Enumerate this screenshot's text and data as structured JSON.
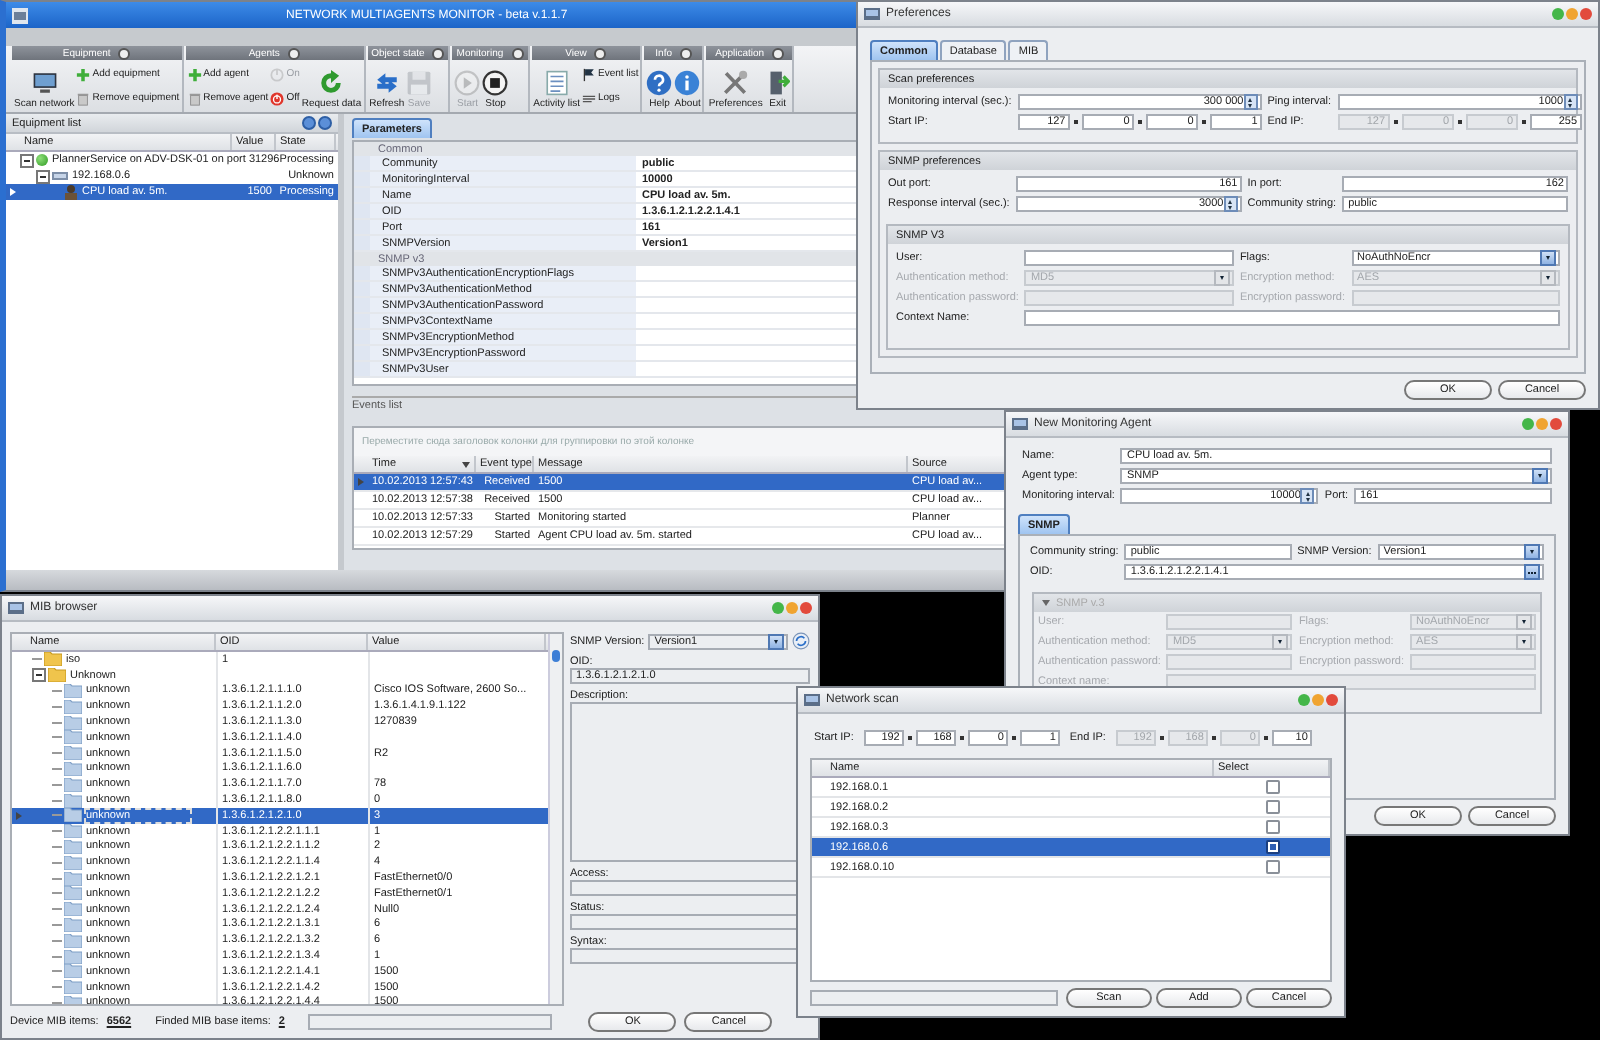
{
  "main_window": {
    "title": "NETWORK MULTIAGENTS MONITOR - beta v.1.1.7",
    "ribbon": [
      {
        "title": "Equipment",
        "buttons": [
          {
            "label": "Scan network",
            "kind": "large",
            "disabled": false
          },
          {
            "label": "Add equipment",
            "kind": "small",
            "disabled": false
          },
          {
            "label": "Remove equipment",
            "kind": "small",
            "disabled": false
          }
        ]
      },
      {
        "title": "Agents",
        "buttons": [
          {
            "label": "Add agent",
            "kind": "small",
            "disabled": false
          },
          {
            "label": "Remove agent",
            "kind": "small",
            "disabled": false
          },
          {
            "label": "On",
            "kind": "small",
            "disabled": true
          },
          {
            "label": "Off",
            "kind": "small",
            "disabled": false
          },
          {
            "label": "Request data",
            "kind": "large",
            "disabled": false
          }
        ]
      },
      {
        "title": "Object state",
        "buttons": [
          {
            "label": "Refresh",
            "kind": "large",
            "disabled": false
          },
          {
            "label": "Save",
            "kind": "large",
            "disabled": true
          }
        ]
      },
      {
        "title": "Monitoring",
        "buttons": [
          {
            "label": "Start",
            "kind": "large",
            "disabled": true
          },
          {
            "label": "Stop",
            "kind": "large",
            "disabled": false
          }
        ]
      },
      {
        "title": "View",
        "buttons": [
          {
            "label": "Activity list",
            "kind": "large",
            "disabled": false
          },
          {
            "label": "Event list",
            "kind": "small",
            "disabled": false
          },
          {
            "label": "Logs",
            "kind": "small",
            "disabled": false
          }
        ]
      },
      {
        "title": "Info",
        "buttons": [
          {
            "label": "Help",
            "kind": "large",
            "disabled": false
          },
          {
            "label": "About",
            "kind": "large",
            "disabled": false
          }
        ]
      },
      {
        "title": "Application",
        "buttons": [
          {
            "label": "Preferences",
            "kind": "large",
            "disabled": false
          },
          {
            "label": "Exit",
            "kind": "large",
            "disabled": false
          }
        ]
      }
    ],
    "equipment_list": {
      "title": "Equipment list",
      "columns": [
        "Name",
        "Value",
        "State"
      ],
      "rows": [
        {
          "name": "PlannerService on ADV-DSK-01 on port 31296",
          "state": "Processing",
          "selected": false,
          "expanded": true,
          "children": [
            {
              "name": "192.168.0.6",
              "state": "Unknown",
              "selected": false,
              "expanded": true,
              "children": [
                {
                  "name": "CPU load av. 5m.",
                  "value": "1500",
                  "state": "Processing",
                  "selected": true
                }
              ]
            }
          ]
        }
      ]
    },
    "parameters": {
      "tabs": [
        {
          "label": "Parameters",
          "selected": true
        }
      ],
      "categories": [
        {
          "title": "Common",
          "rows": [
            {
              "name": "Community",
              "value": "public"
            },
            {
              "name": "MonitoringInterval",
              "value": "10000"
            },
            {
              "name": "Name",
              "value": "CPU load av. 5m."
            },
            {
              "name": "OID",
              "value": "1.3.6.1.2.1.2.2.1.4.1"
            },
            {
              "name": "Port",
              "value": "161"
            },
            {
              "name": "SNMPVersion",
              "value": "Version1"
            }
          ]
        },
        {
          "title": "SNMP v3",
          "rows": [
            {
              "name": "SNMPv3AuthenticationEncryptionFlags"
            },
            {
              "name": "SNMPv3AuthenticationMethod"
            },
            {
              "name": "SNMPv3AuthenticationPassword"
            },
            {
              "name": "SNMPv3ContextName"
            },
            {
              "name": "SNMPv3EncryptionMethod"
            },
            {
              "name": "SNMPv3EncryptionPassword"
            },
            {
              "name": "SNMPv3User"
            }
          ]
        }
      ]
    },
    "events_list": {
      "title": "Events list",
      "group_hint": "Переместите сюда заголовок колонки для группировки по этой колонке",
      "columns": [
        "Time",
        "Event type",
        "Message",
        "Source"
      ],
      "rows": [
        {
          "time": "10.02.2013 12:57:43",
          "event_type": "Received",
          "message": "1500",
          "source": "CPU load av...",
          "selected": true
        },
        {
          "time": "10.02.2013 12:57:38",
          "event_type": "Received",
          "message": "1500",
          "source": "CPU load av...",
          "selected": false
        },
        {
          "time": "10.02.2013 12:57:33",
          "event_type": "Started",
          "message": "Monitoring started",
          "source": "Planner",
          "selected": false
        },
        {
          "time": "10.02.2013 12:57:29",
          "event_type": "Started",
          "message": "Agent CPU load av. 5m. started",
          "source": "CPU load av...",
          "selected": false
        }
      ]
    }
  },
  "preferences": {
    "title": "Preferences",
    "tabs": [
      {
        "label": "Common",
        "selected": true
      },
      {
        "label": "Database",
        "selected": false
      },
      {
        "label": "MIB",
        "selected": false
      }
    ],
    "sections": [
      {
        "title": "Scan preferences",
        "rows": [
          [
            {
              "label": "Monitoring interval (sec.):",
              "kind": "spin",
              "value": "300 000"
            },
            {
              "label": "Ping interval:",
              "kind": "spin",
              "value": "1000"
            }
          ],
          [
            {
              "label": "Start IP:",
              "kind": "ip",
              "octets": [
                {
                  "value": "127",
                  "disabled": false
                },
                {
                  "value": "0",
                  "disabled": false
                },
                {
                  "value": "0",
                  "disabled": false
                },
                {
                  "value": "1",
                  "disabled": false
                }
              ]
            },
            {
              "label": "End IP:",
              "kind": "ip",
              "octets": [
                {
                  "value": "127",
                  "disabled": true
                },
                {
                  "value": "0",
                  "disabled": true
                },
                {
                  "value": "0",
                  "disabled": true
                },
                {
                  "value": "255",
                  "disabled": false
                }
              ]
            }
          ]
        ]
      },
      {
        "title": "SNMP preferences",
        "rows": [
          [
            {
              "label": "Out port:",
              "kind": "number",
              "value": "161"
            },
            {
              "label": "In port:",
              "kind": "number",
              "value": "162"
            }
          ],
          [
            {
              "label": "Response interval (sec.):",
              "kind": "spin",
              "value": "3000"
            },
            {
              "label": "Community string:",
              "kind": "text",
              "value": "public"
            }
          ]
        ],
        "group": {
          "title": "SNMP V3",
          "rows": [
            [
              {
                "label": "User:",
                "kind": "text",
                "disabled": false
              },
              {
                "label": "Flags:",
                "kind": "combo",
                "value": "NoAuthNoEncr",
                "disabled": false
              }
            ],
            [
              {
                "label": "Authentication method:",
                "kind": "combo",
                "value": "MD5",
                "disabled": true
              },
              {
                "label": "Encryption method:",
                "kind": "combo",
                "value": "AES",
                "disabled": true
              }
            ],
            [
              {
                "label": "Authentication password:",
                "kind": "text",
                "disabled": true
              },
              {
                "label": "Encryption password:",
                "kind": "text",
                "disabled": true
              }
            ],
            [
              {
                "label": "Context Name:",
                "kind": "text",
                "disabled": false
              }
            ]
          ]
        }
      }
    ],
    "buttons": [
      "OK",
      "Cancel"
    ]
  },
  "new_agent": {
    "title": "New Monitoring Agent",
    "rows": [
      [
        {
          "label": "Name:",
          "kind": "text",
          "value": "CPU load av. 5m."
        }
      ],
      [
        {
          "label": "Agent type:",
          "kind": "combo",
          "value": "SNMP"
        }
      ],
      [
        {
          "label": "Monitoring interval:",
          "kind": "spin",
          "value": "10000"
        },
        {
          "label": "Port:",
          "kind": "text",
          "value": "161"
        }
      ]
    ],
    "tabs": [
      {
        "label": "SNMP",
        "selected": true
      }
    ],
    "snmp_rows": [
      [
        {
          "label": "Community string:",
          "kind": "text",
          "value": "public"
        },
        {
          "label": "SNMP Version:",
          "kind": "combo",
          "value": "Version1"
        }
      ],
      [
        {
          "label": "OID:",
          "kind": "browse",
          "value": "1.3.6.1.2.1.2.2.1.4.1"
        }
      ]
    ],
    "snmp_v3": {
      "title": "SNMP v.3",
      "expanded": true,
      "disabled": true,
      "rows": [
        [
          {
            "label": "User:",
            "kind": "text"
          },
          {
            "label": "Flags:",
            "kind": "combo",
            "value": "NoAuthNoEncr"
          }
        ],
        [
          {
            "label": "Authentication method:",
            "kind": "combo",
            "value": "MD5"
          },
          {
            "label": "Encryption method:",
            "kind": "combo",
            "value": "AES"
          }
        ],
        [
          {
            "label": "Authentication password:",
            "kind": "text"
          },
          {
            "label": "Encryption password:",
            "kind": "text"
          }
        ],
        [
          {
            "label": "Context name:",
            "kind": "text"
          }
        ]
      ]
    },
    "buttons": [
      "OK",
      "Cancel"
    ]
  },
  "mib_browser": {
    "title": "MIB browser",
    "columns": [
      "Name",
      "OID",
      "Value"
    ],
    "rows": [
      {
        "name": "iso",
        "oid": "1",
        "selected": false
      },
      {
        "name": "Unknown",
        "selected": false,
        "expanded": true,
        "children": [
          {
            "name": "unknown",
            "oid": "1.3.6.1.2.1.1.1.0",
            "value": "Cisco IOS Software, 2600 So...",
            "selected": false
          },
          {
            "name": "unknown",
            "oid": "1.3.6.1.2.1.1.2.0",
            "value": "1.3.6.1.4.1.9.1.122",
            "selected": false
          },
          {
            "name": "unknown",
            "oid": "1.3.6.1.2.1.1.3.0",
            "value": "1270839",
            "selected": false
          },
          {
            "name": "unknown",
            "oid": "1.3.6.1.2.1.1.4.0",
            "selected": false
          },
          {
            "name": "unknown",
            "oid": "1.3.6.1.2.1.1.5.0",
            "value": "R2",
            "selected": false
          },
          {
            "name": "unknown",
            "oid": "1.3.6.1.2.1.1.6.0",
            "selected": false
          },
          {
            "name": "unknown",
            "oid": "1.3.6.1.2.1.1.7.0",
            "value": "78",
            "selected": false
          },
          {
            "name": "unknown",
            "oid": "1.3.6.1.2.1.1.8.0",
            "value": "0",
            "selected": false
          },
          {
            "name": "unknown",
            "oid": "1.3.6.1.2.1.2.1.0",
            "value": "3",
            "selected": true
          },
          {
            "name": "unknown",
            "oid": "1.3.6.1.2.1.2.2.1.1.1",
            "value": "1",
            "selected": false
          },
          {
            "name": "unknown",
            "oid": "1.3.6.1.2.1.2.2.1.1.2",
            "value": "2",
            "selected": false
          },
          {
            "name": "unknown",
            "oid": "1.3.6.1.2.1.2.2.1.1.4",
            "value": "4",
            "selected": false
          },
          {
            "name": "unknown",
            "oid": "1.3.6.1.2.1.2.2.1.2.1",
            "value": "FastEthernet0/0",
            "selected": false
          },
          {
            "name": "unknown",
            "oid": "1.3.6.1.2.1.2.2.1.2.2",
            "value": "FastEthernet0/1",
            "selected": false
          },
          {
            "name": "unknown",
            "oid": "1.3.6.1.2.1.2.2.1.2.4",
            "value": "Null0",
            "selected": false
          },
          {
            "name": "unknown",
            "oid": "1.3.6.1.2.1.2.2.1.3.1",
            "value": "6",
            "selected": false
          },
          {
            "name": "unknown",
            "oid": "1.3.6.1.2.1.2.2.1.3.2",
            "value": "6",
            "selected": false
          },
          {
            "name": "unknown",
            "oid": "1.3.6.1.2.1.2.2.1.3.4",
            "value": "1",
            "selected": false
          },
          {
            "name": "unknown",
            "oid": "1.3.6.1.2.1.2.2.1.4.1",
            "value": "1500",
            "selected": false
          },
          {
            "name": "unknown",
            "oid": "1.3.6.1.2.1.2.2.1.4.2",
            "value": "1500",
            "selected": false
          },
          {
            "name": "unknown",
            "oid": "1.3.6.1.2.1.2.2.1.4.4",
            "value": "1500",
            "selected": false
          }
        ]
      }
    ],
    "snmp_version": {
      "label": "SNMP Version:",
      "kind": "combo",
      "value": "Version1"
    },
    "fields": [
      {
        "label": "OID:",
        "kind": "text",
        "value": "1.3.6.1.2.1.2.1.0"
      },
      {
        "label": "Description:",
        "kind": "memo"
      },
      {
        "label": "Access:",
        "kind": "text"
      },
      {
        "label": "Status:",
        "kind": "text"
      },
      {
        "label": "Syntax:",
        "kind": "text"
      }
    ],
    "footer": [
      {
        "label": "Device MIB items:",
        "value": "6562"
      },
      {
        "label": "Finded MIB base items:",
        "value": "2"
      }
    ],
    "progress": {
      "level": 0
    },
    "buttons": [
      "OK",
      "Cancel"
    ]
  },
  "network_scan": {
    "title": "Network scan",
    "ip_range": [
      {
        "label": "Start IP:",
        "kind": "ip",
        "octets": [
          {
            "value": "192",
            "disabled": false
          },
          {
            "value": "168",
            "disabled": false
          },
          {
            "value": "0",
            "disabled": false
          },
          {
            "value": "1",
            "disabled": false
          }
        ]
      },
      {
        "label": "End IP:",
        "kind": "ip",
        "octets": [
          {
            "value": "192",
            "disabled": true
          },
          {
            "value": "168",
            "disabled": true
          },
          {
            "value": "0",
            "disabled": true
          },
          {
            "value": "10",
            "disabled": false
          }
        ]
      }
    ],
    "columns": [
      "Name",
      "Select"
    ],
    "hosts": [
      {
        "name": "192.168.0.1",
        "checked": false,
        "selected": false
      },
      {
        "name": "192.168.0.2",
        "checked": false,
        "selected": false
      },
      {
        "name": "192.168.0.3",
        "checked": false,
        "selected": false
      },
      {
        "name": "192.168.0.6",
        "checked": true,
        "selected": true
      },
      {
        "name": "192.168.0.10",
        "checked": false,
        "selected": false
      }
    ],
    "progress": {
      "level": 0
    },
    "buttons": [
      "Scan",
      "Add",
      "Cancel"
    ]
  }
}
